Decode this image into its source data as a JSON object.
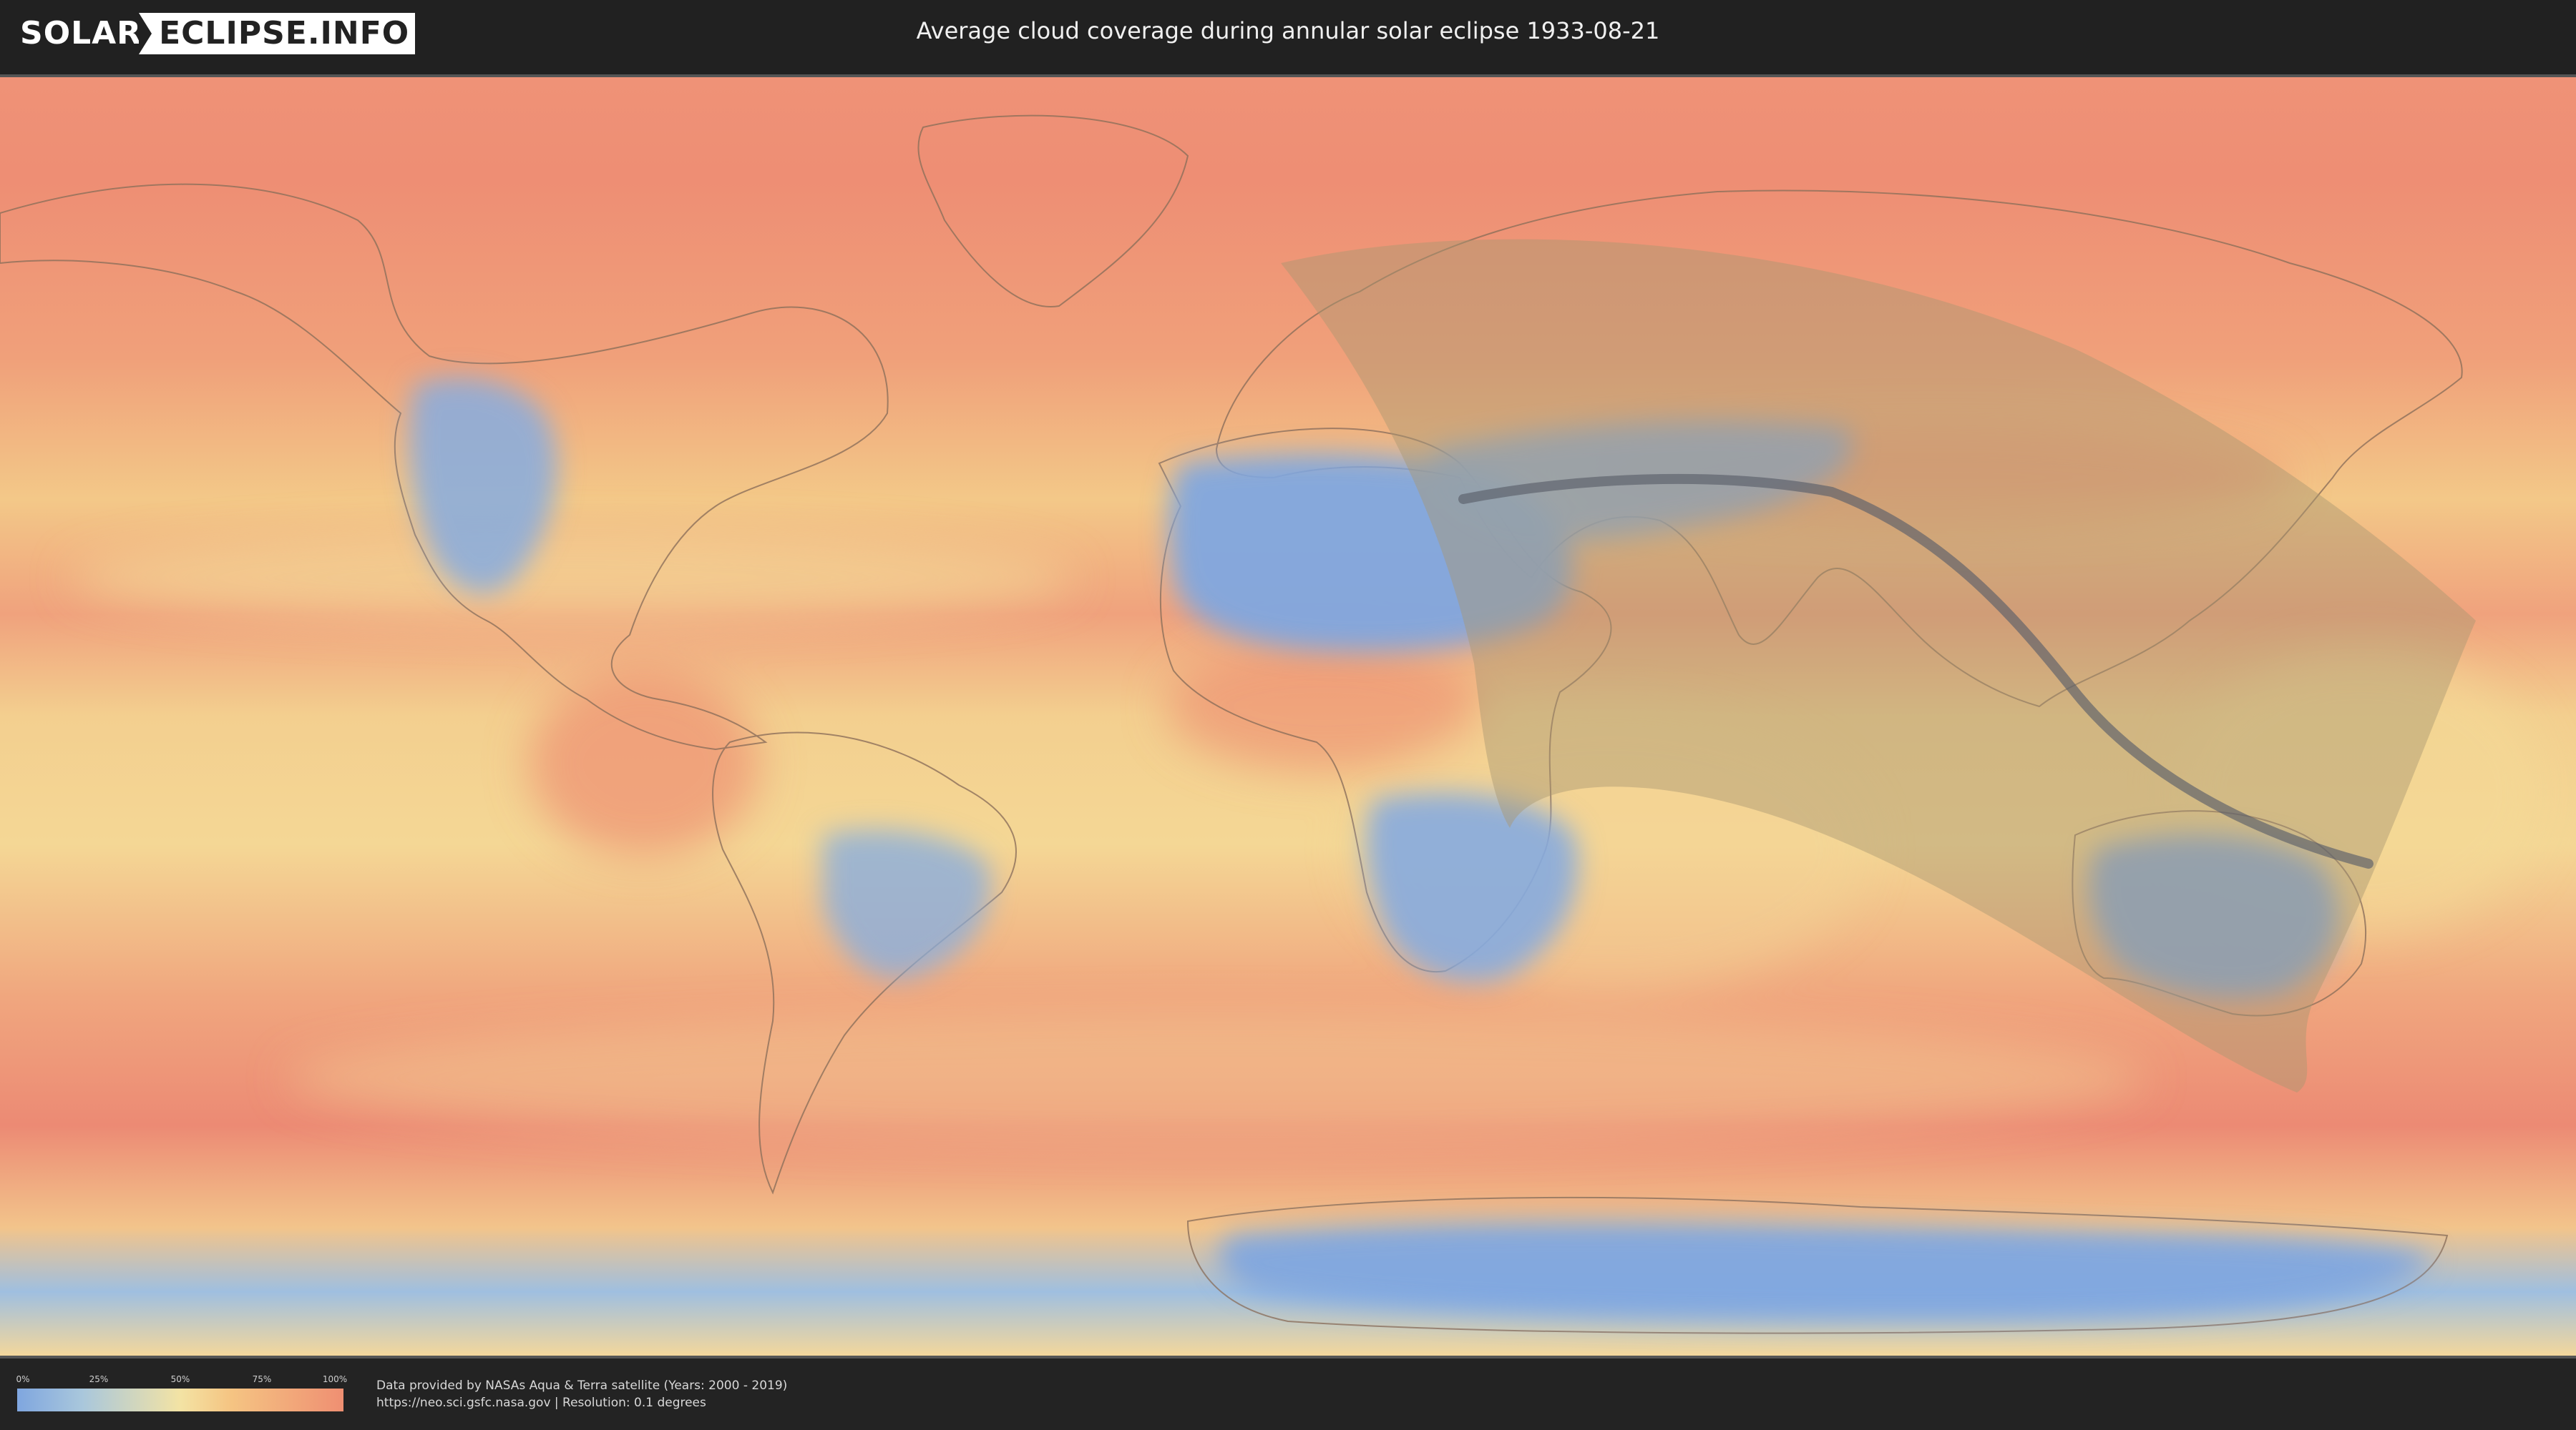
{
  "header": {
    "logo_left": "SOLAR",
    "logo_right": "ECLIPSE.INFO",
    "title": "Average cloud coverage during annular solar eclipse 1933-08-21"
  },
  "legend": {
    "ticks": [
      "0%",
      "25%",
      "50%",
      "75%",
      "100%"
    ],
    "colors": [
      "#7fa6df",
      "#f3e3a4",
      "#ef8f72"
    ]
  },
  "credits": {
    "line1": "Data provided by NASAs Aqua & Terra satellite (Years: 2000 - 2019)",
    "line2": "https://neo.sci.gsfc.nasa.gov | Resolution: 0.1 degrees"
  },
  "map": {
    "projection": "equirectangular",
    "palette": {
      "clear": "#7fa6df",
      "mid": "#f3e3a4",
      "cloudy": "#ef8f72",
      "path": "#a89670",
      "centerline": "#5a5f6a"
    }
  }
}
